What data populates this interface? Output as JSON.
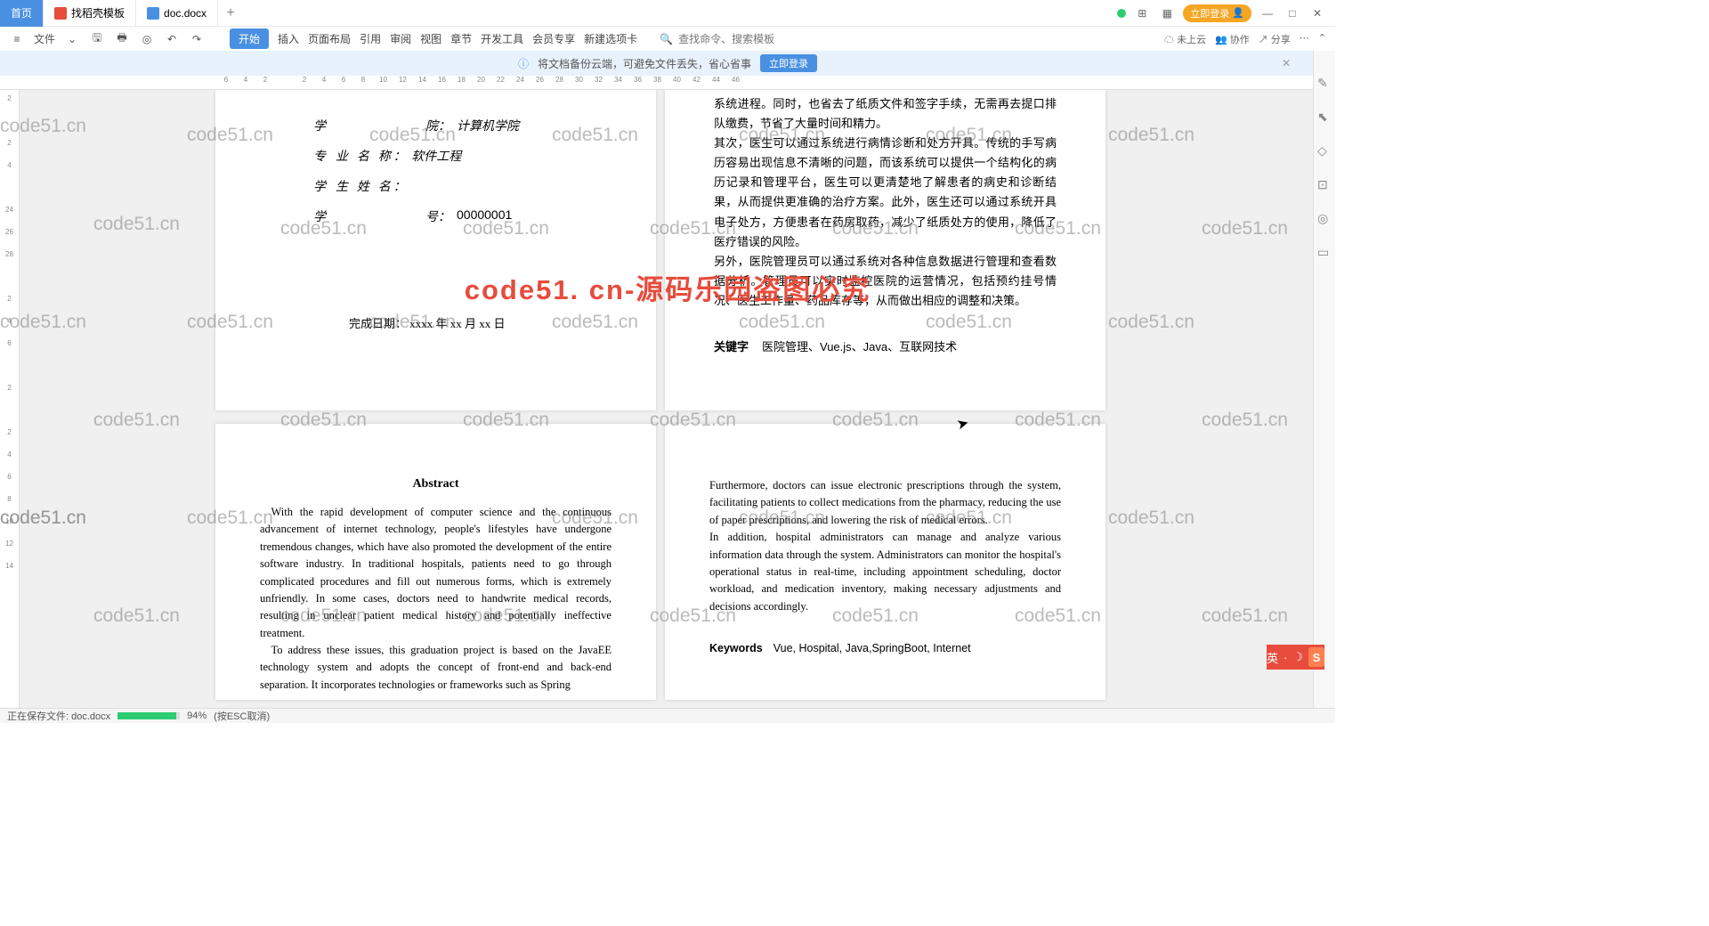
{
  "tabs": {
    "home": "首页",
    "t1": "找稻壳模板",
    "t2": "doc.docx"
  },
  "titlebar": {
    "login": "立即登录"
  },
  "toolbar": {
    "file": "文件",
    "menus": [
      "开始",
      "插入",
      "页面布局",
      "引用",
      "审阅",
      "视图",
      "章节",
      "开发工具",
      "会员专享",
      "新建选项卡"
    ],
    "search_ph": "查找命令、搜索模板",
    "cloud": "未上云",
    "collab": "协作",
    "share": "分享"
  },
  "banner": {
    "text": "将文档备份云端，可避免文件丢失，省心省事",
    "btn": "立即登录"
  },
  "ruler_h": [
    "6",
    "4",
    "2",
    "",
    "2",
    "4",
    "6",
    "8",
    "10",
    "12",
    "14",
    "16",
    "18",
    "20",
    "22",
    "24",
    "26",
    "28",
    "30",
    "32",
    "34",
    "36",
    "38",
    "40",
    "42",
    "44",
    "46"
  ],
  "ruler_v": [
    "2",
    "",
    "2",
    "4",
    "",
    "24",
    "26",
    "28",
    "",
    "2",
    "4",
    "6",
    "",
    "2",
    "",
    "2",
    "4",
    "6",
    "8",
    "10",
    "12",
    "14"
  ],
  "page1": {
    "r1l": "学",
    "r1l2": "院：",
    "r1v": "计算机学院",
    "r2l": "专",
    "r2l2": "业 名 称：",
    "r2v": "软件工程",
    "r3l": "学",
    "r3l2": "生 姓 名：",
    "r3v": "",
    "r4l": "学",
    "r4l2": "号：",
    "r4v": "00000001",
    "date": "完成日期：   xxxx 年  xx 月 xx 日"
  },
  "page2": {
    "body": "系统进程。同时，也省去了纸质文件和签字手续，无需再去提口排队缴费，节省了大量时间和精力。\n其次，医生可以通过系统进行病情诊断和处方开具。传统的手写病历容易出现信息不清晰的问题，而该系统可以提供一个结构化的病历记录和管理平台，医生可以更清楚地了解患者的病史和诊断结果，从而提供更准确的治疗方案。此外，医生还可以通过系统开具电子处方，方便患者在药房取药，减少了纸质处方的使用，降低了医疗错误的风险。\n另外，医院管理员可以通过系统对各种信息数据进行管理和查看数据分析。管理员可以实时监控医院的运营情况，包括预约挂号情况、医生工作量、药品库存等，从而做出相应的调整和决策。",
    "kw_label": "关键字",
    "kw": "医院管理、Vue.js、Java、互联网技术"
  },
  "page3": {
    "title": "Abstract",
    "body": "With the rapid development of computer science and the continuous advancement of internet technology, people's lifestyles have undergone tremendous changes, which have also promoted the development of the entire software industry. In traditional hospitals, patients need to go through complicated procedures and fill out numerous forms, which is extremely unfriendly. In some cases, doctors need to handwrite medical records, resulting in unclear patient medical history and potentially ineffective treatment.",
    "body2": "To address these issues, this graduation project is based on the JavaEE technology system and adopts the concept of front-end and back-end separation. It incorporates technologies or frameworks such as Spring"
  },
  "page4": {
    "body": "Furthermore, doctors can issue electronic prescriptions through the system, facilitating patients to collect medications from the pharmacy, reducing the use of paper prescriptions, and lowering the risk of medical errors.",
    "body2": "In addition, hospital administrators can manage and analyze various information data through the system. Administrators can monitor the hospital's operational status in real-time, including appointment scheduling, doctor workload, and medication inventory, making necessary adjustments and decisions accordingly.",
    "kw_label": "Keywords",
    "kw": "Vue, Hospital, Java,SpringBoot, Internet"
  },
  "watermark": "code51.cn",
  "big_watermark": "code51. cn-源码乐园盗图必究",
  "status": {
    "saving": "正在保存文件: doc.docx",
    "pct": "94%",
    "esc": "(按ESC取消)"
  },
  "ime": {
    "lang": "英"
  }
}
